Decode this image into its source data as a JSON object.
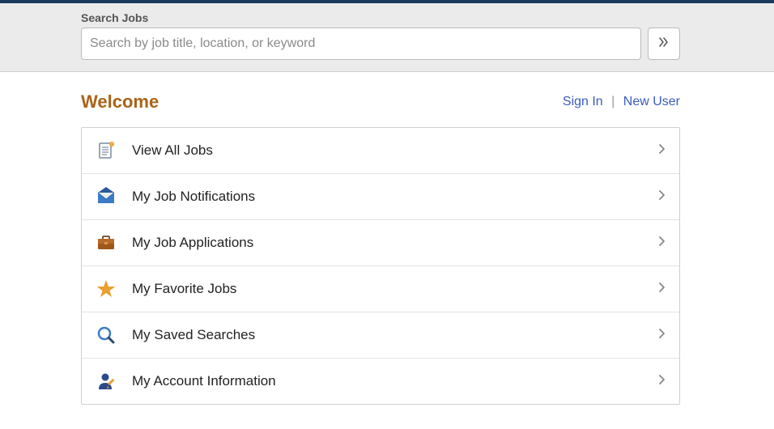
{
  "search": {
    "label": "Search Jobs",
    "placeholder": "Search by job title, location, or keyword"
  },
  "header": {
    "title": "Welcome",
    "signin_label": "Sign In",
    "newuser_label": "New User",
    "separator": "|"
  },
  "menu": {
    "items": [
      {
        "label": "View All Jobs"
      },
      {
        "label": "My Job Notifications"
      },
      {
        "label": "My Job Applications"
      },
      {
        "label": "My Favorite Jobs"
      },
      {
        "label": "My Saved Searches"
      },
      {
        "label": "My Account Information"
      }
    ]
  }
}
